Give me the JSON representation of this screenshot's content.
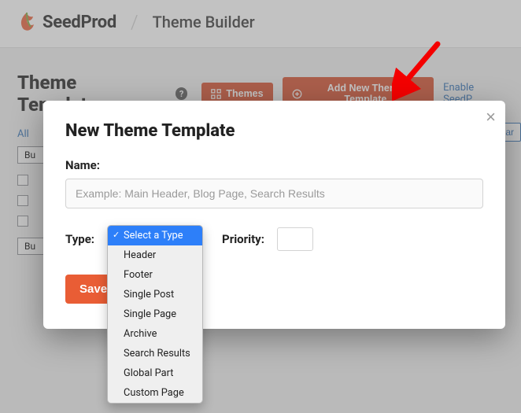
{
  "header": {
    "brand": "SeedProd",
    "page": "Theme Builder"
  },
  "main": {
    "heading": "Theme Templates",
    "themes_btn": "Themes",
    "add_btn": "Add New Theme Template",
    "enable": "Enable SeedP",
    "filter_all": "All",
    "bulk_placeholder": "Bu",
    "search_btn": "Sear"
  },
  "modal": {
    "title": "New Theme Template",
    "name_label": "Name:",
    "name_placeholder": "Example: Main Header, Blog Page, Search Results",
    "type_label": "Type:",
    "priority_label": "Priority:",
    "save": "Save",
    "type_options": [
      "Select a Type",
      "Header",
      "Footer",
      "Single Post",
      "Single Page",
      "Archive",
      "Search Results",
      "Global Part",
      "Custom Page"
    ]
  }
}
